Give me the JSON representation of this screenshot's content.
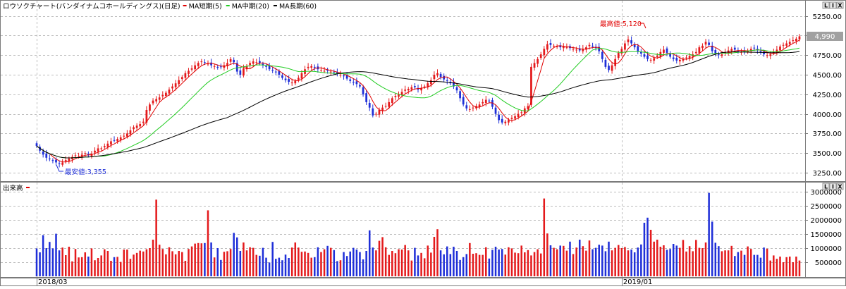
{
  "colors": {
    "up": "#e41a1c",
    "down": "#1f2fd8",
    "ma_short": "#e00000",
    "ma_mid": "#22cc22",
    "ma_long": "#000000",
    "grid": "#bdbdbd",
    "frame": "#7a7a7a",
    "last_price_box": "#a0a0a0",
    "annotation_high": "#e00000",
    "annotation_low": "#1f2fd8",
    "volume_legend": "#e00000"
  },
  "window_buttons": [
    "L",
    "I",
    "X"
  ],
  "price_panel": {
    "title": "ロウソクチャート(バンダイナムコホールディングス)(日足)",
    "legend": [
      {
        "label": "MA短期(5)",
        "color": "#e00000"
      },
      {
        "label": "MA中期(20)",
        "color": "#22cc22"
      },
      {
        "label": "MA長期(60)",
        "color": "#000000"
      }
    ],
    "last_price_label": "4,990",
    "high_annotation": "最高値:5,120",
    "low_annotation": "最安値:3,355"
  },
  "volume_panel": {
    "title": "出来高",
    "legend_color": "#e00000"
  },
  "x_labels": [
    "2018/03",
    "2019/01"
  ],
  "chart_data": [
    {
      "type": "candlestick",
      "title": "ロウソクチャート(バンダイナムコホールディングス)(日足)",
      "series": [
        {
          "name": "MA短期(5)",
          "values": []
        },
        {
          "name": "MA中期(20)",
          "values": []
        },
        {
          "name": "MA長期(60)",
          "values": []
        }
      ],
      "ylim": [
        3150,
        5400
      ],
      "y_ticks": [
        3250,
        3500,
        3750,
        4000,
        4250,
        4500,
        4750,
        5000,
        5250
      ],
      "y_tick_labels": [
        "3250.00",
        "3500.00",
        "3750.00",
        "4000.00",
        "4250.00",
        "4500.00",
        "4750.00",
        "5000.00",
        "5250.00"
      ],
      "x_tick_labels": [
        "2018/03",
        "2019/01"
      ],
      "closes": [
        3590,
        3530,
        3480,
        3440,
        3420,
        3400,
        3380,
        3360,
        3380,
        3410,
        3430,
        3450,
        3470,
        3460,
        3480,
        3500,
        3470,
        3490,
        3530,
        3560,
        3560,
        3590,
        3620,
        3650,
        3660,
        3680,
        3700,
        3720,
        3750,
        3790,
        3830,
        3850,
        3870,
        3900,
        4050,
        4120,
        4170,
        4190,
        4210,
        4240,
        4270,
        4310,
        4350,
        4390,
        4430,
        4470,
        4520,
        4550,
        4580,
        4620,
        4650,
        4670,
        4650,
        4640,
        4620,
        4610,
        4590,
        4600,
        4620,
        4650,
        4700,
        4660,
        4540,
        4500,
        4580,
        4610,
        4650,
        4670,
        4660,
        4650,
        4620,
        4600,
        4570,
        4550,
        4530,
        4500,
        4460,
        4430,
        4410,
        4400,
        4420,
        4460,
        4520,
        4570,
        4600,
        4610,
        4590,
        4570,
        4560,
        4550,
        4550,
        4540,
        4520,
        4510,
        4500,
        4480,
        4450,
        4420,
        4400,
        4380,
        4350,
        4250,
        4150,
        4080,
        3980,
        4000,
        4050,
        4080,
        4100,
        4150,
        4200,
        4230,
        4250,
        4280,
        4310,
        4320,
        4340,
        4340,
        4310,
        4330,
        4350,
        4390,
        4430,
        4500,
        4520,
        4470,
        4440,
        4420,
        4390,
        4350,
        4300,
        4200,
        4120,
        4070,
        4060,
        4080,
        4100,
        4120,
        4150,
        4180,
        4160,
        4090,
        4000,
        3920,
        3890,
        3900,
        3920,
        3950,
        3970,
        4000,
        4020,
        4070,
        4100,
        4600,
        4650,
        4700,
        4760,
        4830,
        4890,
        4880,
        4870,
        4860,
        4850,
        4860,
        4850,
        4840,
        4830,
        4820,
        4810,
        4830,
        4850,
        4880,
        4860,
        4840,
        4800,
        4700,
        4600,
        4560,
        4620,
        4700,
        4780,
        4830,
        4900,
        4950,
        4900,
        4850,
        4800,
        4770,
        4730,
        4700,
        4690,
        4710,
        4740,
        4790,
        4820,
        4780,
        4730,
        4700,
        4680,
        4690,
        4700,
        4720,
        4740,
        4760,
        4790,
        4850,
        4870,
        4920,
        4880,
        4800,
        4770,
        4750,
        4760,
        4790,
        4810,
        4830,
        4820,
        4800,
        4790,
        4800,
        4810,
        4830,
        4840,
        4810,
        4780,
        4760,
        4750,
        4760,
        4790,
        4820,
        4860,
        4880,
        4900,
        4920,
        4940,
        4960,
        4990
      ],
      "volumes": [
        990000,
        850000,
        1460000,
        1000000,
        1220000,
        990000,
        1510000,
        920000,
        1020000,
        750000,
        1050000,
        530000,
        970000,
        670000,
        680000,
        850000,
        700000,
        990000,
        570000,
        650000,
        740000,
        960000,
        900000,
        550000,
        680000,
        690000,
        510000,
        950000,
        950000,
        620000,
        770000,
        830000,
        910000,
        880000,
        960000,
        1000000,
        1300000,
        2720000,
        1120000,
        970000,
        780000,
        1030000,
        890000,
        780000,
        900000,
        860000,
        550000,
        970000,
        1060000,
        1160000,
        1180000,
        1170000,
        1180000,
        2340000,
        1200000,
        670000,
        1000000,
        580000,
        870000,
        890000,
        970000,
        1540000,
        1380000,
        900000,
        1200000,
        920000,
        1030000,
        1010000,
        760000,
        730000,
        1010000,
        660000,
        490000,
        1220000,
        620000,
        660000,
        570000,
        770000,
        650000,
        1020000,
        1200000,
        1020000,
        870000,
        880000,
        830000,
        660000,
        680000,
        1030000,
        860000,
        960000,
        1080000,
        1010000,
        930000,
        540000,
        570000,
        860000,
        720000,
        880000,
        1010000,
        950000,
        860000,
        600000,
        900000,
        1630000,
        1020000,
        920000,
        1260000,
        1390000,
        1030000,
        760000,
        900000,
        820000,
        960000,
        950000,
        1110000,
        920000,
        560000,
        1010000,
        740000,
        830000,
        640000,
        1090000,
        840000,
        1400000,
        1670000,
        920000,
        780000,
        1060000,
        790000,
        1050000,
        900000,
        580000,
        680000,
        790000,
        1180000,
        800000,
        820000,
        760000,
        760000,
        1030000,
        630000,
        940000,
        1050000,
        950000,
        970000,
        770000,
        1030000,
        990000,
        840000,
        820000,
        1090000,
        850000,
        930000,
        740000,
        860000,
        960000,
        810000,
        2760000,
        1520000,
        1100000,
        1010000,
        960000,
        1090000,
        1080000,
        910000,
        1230000,
        790000,
        1020000,
        1300000,
        1070000,
        910000,
        1270000,
        960000,
        1010000,
        1120000,
        1090000,
        890000,
        1230000,
        920000,
        1010000,
        1110000,
        1000000,
        1040000,
        920000,
        950000,
        850000,
        1020000,
        1130000,
        1900000,
        2080000,
        1650000,
        1230000,
        1300000,
        1050000,
        1100000,
        940000,
        970000,
        1150000,
        1090000,
        1010000,
        1290000,
        880000,
        1070000,
        890000,
        1290000,
        1010000,
        1000000,
        1200000,
        2960000,
        1940000,
        1190000,
        1070000,
        890000,
        920000,
        920000,
        1080000,
        720000,
        860000,
        910000,
        760000,
        1060000,
        970000,
        760000,
        760000,
        660000,
        1020000,
        980000,
        560000,
        740000,
        620000,
        700000,
        500000,
        680000,
        700000,
        500000,
        700000,
        560000,
        1150000,
        600000,
        600000,
        580000
      ]
    }
  ]
}
